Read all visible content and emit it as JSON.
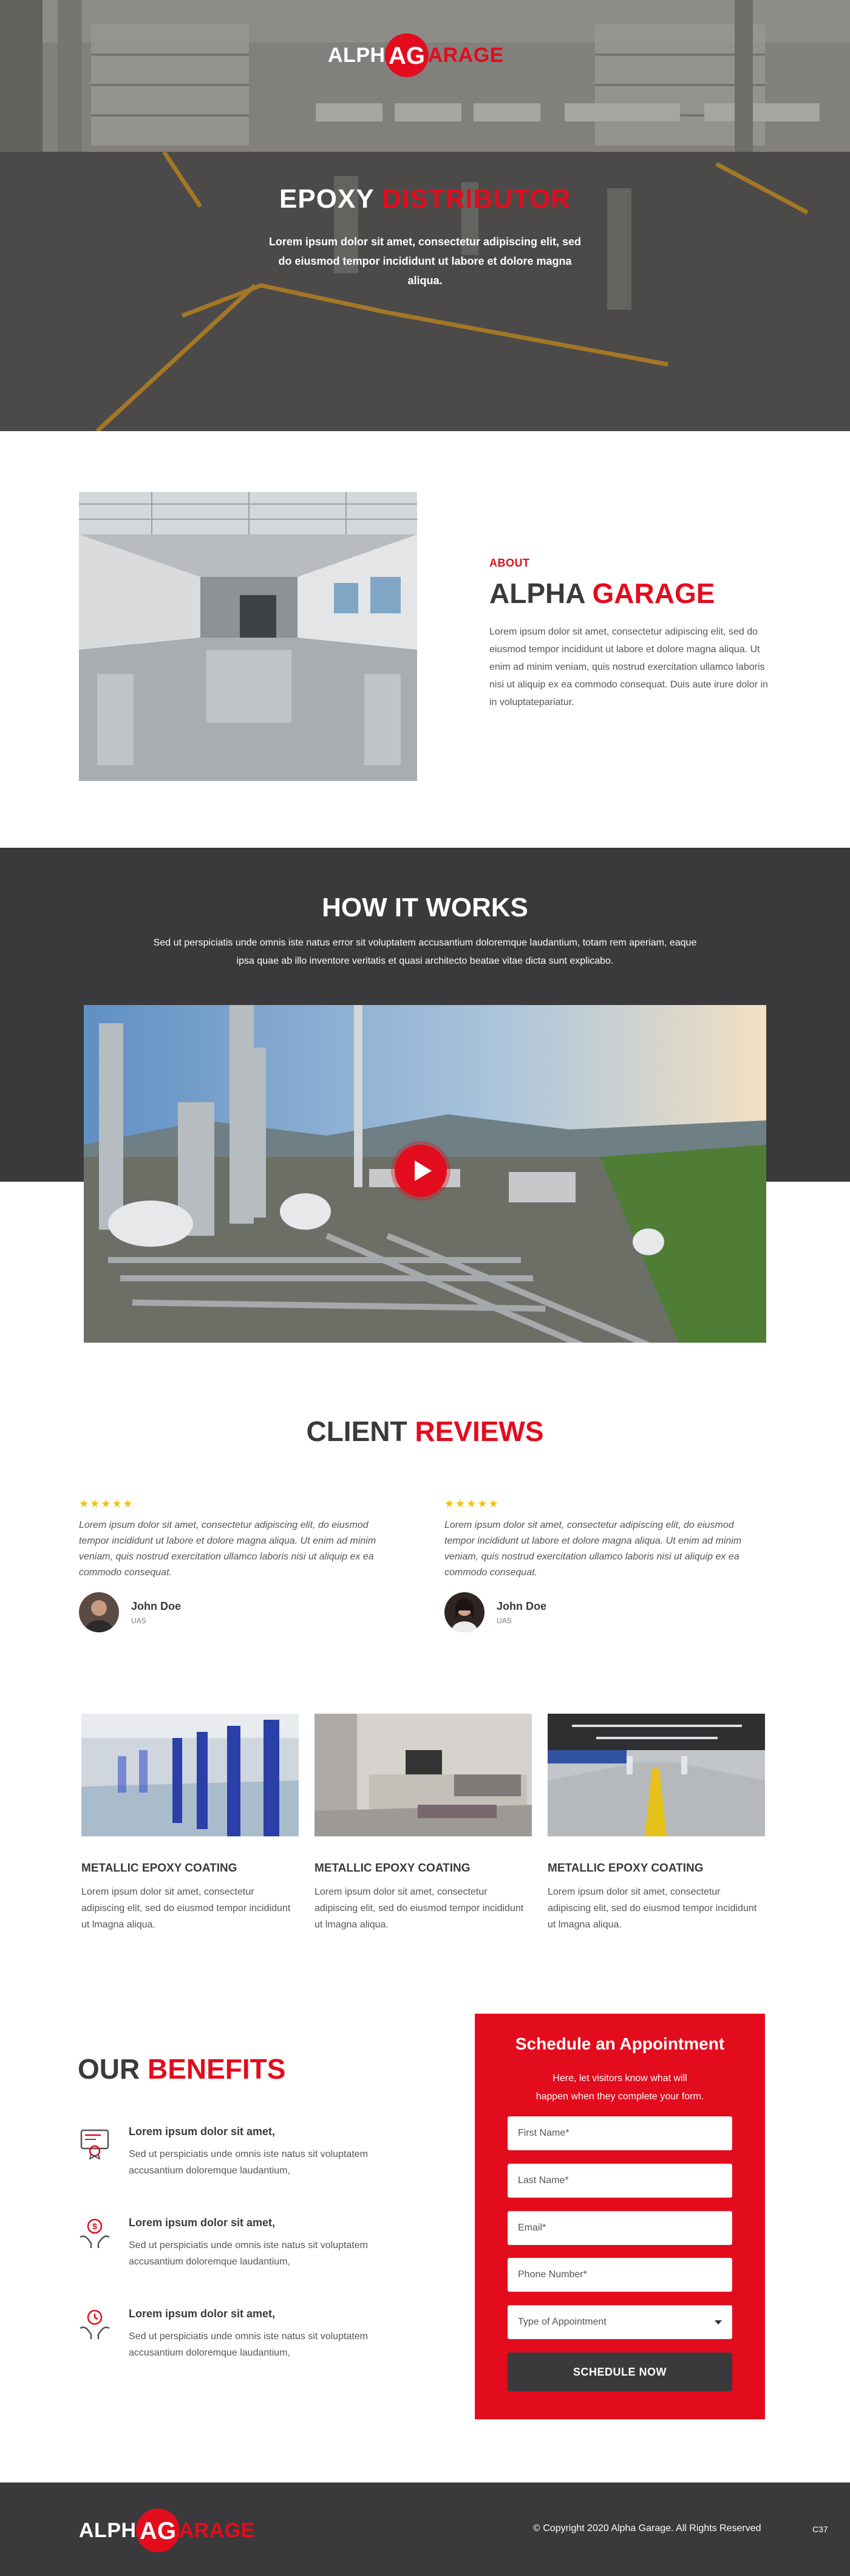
{
  "brand": {
    "part1": "ALPH",
    "part2": "ARAGE",
    "mark": "AG"
  },
  "hero": {
    "title_white": "EPOXY ",
    "title_red": "DISTRIBUTOR",
    "text": "Lorem ipsum dolor sit amet, consectetur adipiscing elit, sed do eiusmod tempor incididunt ut labore et dolore magna aliqua."
  },
  "about": {
    "eyebrow": "ABOUT",
    "title_dark": "ALPHA ",
    "title_red": "GARAGE",
    "text": "Lorem ipsum dolor sit amet, consectetur adipiscing elit, sed do eiusmod tempor incididunt ut labore et dolore magna aliqua. Ut enim ad minim veniam, quis nostrud exercitation ullamco laboris nisi ut aliquip ex ea commodo consequat. Duis aute irure dolor in in voluptatepariatur."
  },
  "how": {
    "title": "HOW IT WORKS",
    "text": "Sed ut perspiciatis unde omnis iste natus error sit voluptatem accusantium doloremque laudantium, totam rem aperiam, eaque ipsa quae ab  illo inventore veritatis et quasi architecto beatae vitae dicta sunt explicabo."
  },
  "reviews": {
    "title_dark": "CLIENT ",
    "title_red": "REVIEWS",
    "items": [
      {
        "stars": "★★★★★",
        "rating": 5,
        "text": "Lorem ipsum dolor sit amet, consectetur adipiscing elit,  do eiusmod tempor incididunt ut labore et dolore magna aliqua. Ut enim ad minim veniam, quis nostrud exercitation ullamco laboris nisi ut aliquip ex ea commodo consequat.",
        "name": "John Doe",
        "location": "UAS"
      },
      {
        "stars": "★★★★★",
        "rating": 5,
        "text": "Lorem ipsum dolor sit amet, consectetur adipiscing elit,  do eiusmod tempor incididunt ut labore et dolore magna aliqua. Ut enim ad minim veniam, quis nostrud exercitation ullamco laboris nisi ut aliquip ex ea commodo consequat.",
        "name": "John Doe",
        "location": "UAS"
      }
    ]
  },
  "services": [
    {
      "title": "METALLIC EPOXY COATING",
      "text": "Lorem ipsum dolor sit amet, consectetur adipiscing elit, sed do eiusmod tempor incididunt ut lmagna aliqua."
    },
    {
      "title": "METALLIC EPOXY COATING",
      "text": "Lorem ipsum dolor sit amet, consectetur adipiscing elit, sed do eiusmod tempor incididunt ut lmagna aliqua."
    },
    {
      "title": "METALLIC EPOXY COATING",
      "text": "Lorem ipsum dolor sit amet, consectetur adipiscing elit, sed do eiusmod tempor incididunt ut lmagna aliqua."
    }
  ],
  "benefits": {
    "title_dark": "OUR ",
    "title_red": "BENEFITS",
    "items": [
      {
        "icon": "certificate-icon",
        "title": "Lorem ipsum dolor sit amet,",
        "text": "Sed ut perspiciatis unde omnis iste natus sit voluptatem accusantium doloremque laudantium,"
      },
      {
        "icon": "money-hands-icon",
        "title": "Lorem ipsum dolor sit amet,",
        "text": "Sed ut perspiciatis unde omnis iste natus sit voluptatem accusantium doloremque laudantium,"
      },
      {
        "icon": "time-hands-icon",
        "title": "Lorem ipsum dolor sit amet,",
        "text": "Sed ut perspiciatis unde omnis iste natus sit voluptatem accusantium doloremque laudantium,"
      }
    ]
  },
  "appointment": {
    "title": "Schedule an Appointment",
    "subtitle": "Here, let visitors know what will happen when they complete your form.",
    "first_name_placeholder": "First Name*",
    "last_name_placeholder": "Last Name*",
    "email_placeholder": "Email*",
    "phone_placeholder": "Phone Number*",
    "type_selected": "Type of Appointment",
    "submit_label": "SCHEDULE NOW"
  },
  "footer": {
    "copyright": "© Copyright 2020 Alpha Garage. All Rights Reserved",
    "code": "C37"
  },
  "colors": {
    "accent": "#e30c1d",
    "dark": "#3a3a3c",
    "star": "#f2c200"
  }
}
